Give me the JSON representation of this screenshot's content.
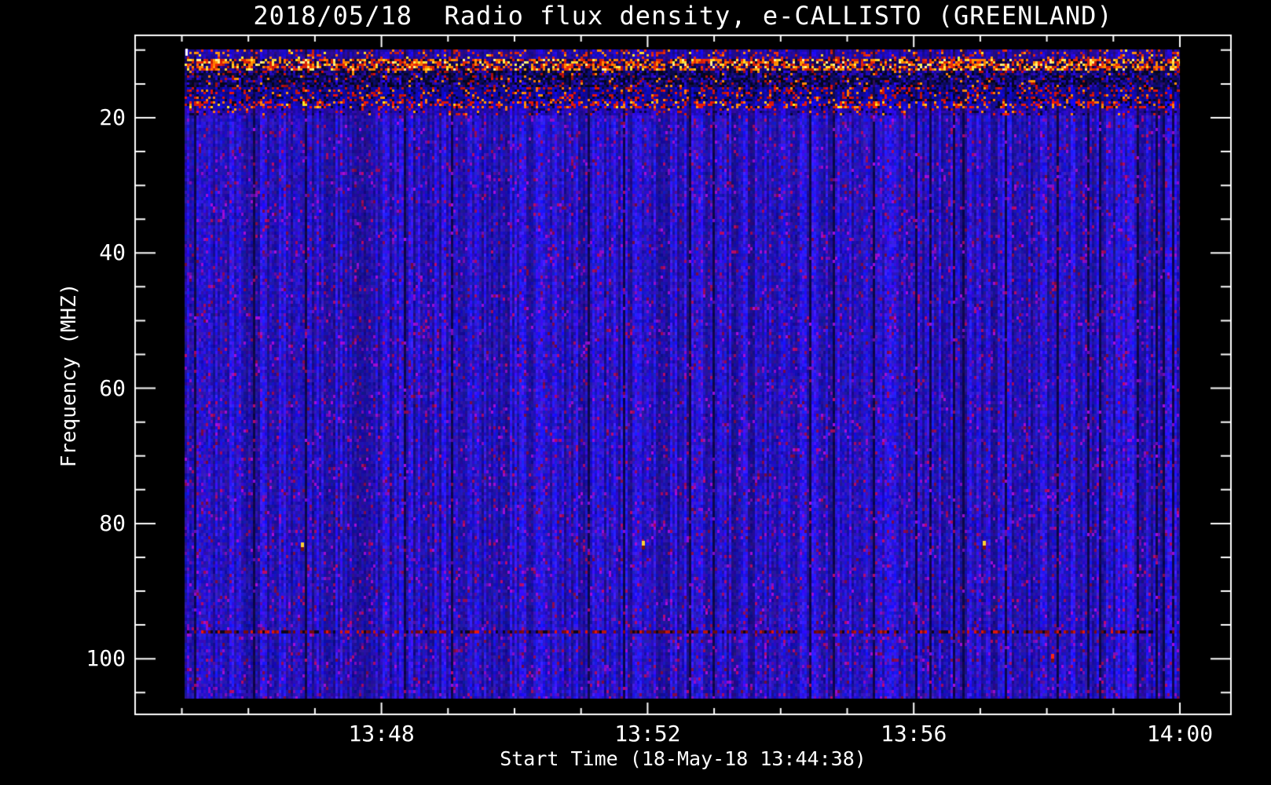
{
  "chart_data": {
    "type": "heatmap",
    "title": "2018/05/18  Radio flux density, e-CALLISTO (GREENLAND)",
    "xlabel": "Start Time (18-May-18 13:44:38)",
    "ylabel": "Frequency (MHZ)",
    "x_axis": {
      "start_time": "13:44:38",
      "end_time": "14:00:00",
      "major_ticks": [
        {
          "time": "13:48:00",
          "label": "13:48"
        },
        {
          "time": "13:52:00",
          "label": "13:52"
        },
        {
          "time": "13:56:00",
          "label": "13:56"
        },
        {
          "time": "14:00:00",
          "label": "14:00"
        }
      ],
      "minor_tick_every_minutes": 1
    },
    "y_axis": {
      "unit": "MHZ",
      "direction": "inverted-low-at-top",
      "data_min_mhz": 9.9,
      "data_max_mhz": 105.9,
      "major_ticks": [
        {
          "value": 20,
          "label": "20"
        },
        {
          "value": 40,
          "label": "40"
        },
        {
          "value": 60,
          "label": "60"
        },
        {
          "value": 80,
          "label": "80"
        },
        {
          "value": 100,
          "label": "100"
        }
      ],
      "minor_tick_every_mhz": 5
    },
    "palette": {
      "background": "#000000",
      "frame": "#ffffff",
      "text": "#ffffff",
      "field_blue": "#2222dd",
      "dark_navy": "#0a0a60",
      "speck_purple": "#7a1ab0",
      "speck_maroon": "#8b1a4a",
      "speck_red": "#d42810",
      "speck_orange": "#ff7a10",
      "speck_yellow": "#ffd330",
      "speck_pale_yellow": "#fff090",
      "fm_dark_red": "#6c1010"
    },
    "interference_bands": [
      {
        "from_mhz": 9.9,
        "to_mhz": 11.2,
        "style": "blue-sparse-red",
        "speck_density": 0.16
      },
      {
        "from_mhz": 11.2,
        "to_mhz": 12.9,
        "style": "intense-red-yellow",
        "speck_density": 0.58
      },
      {
        "from_mhz": 12.9,
        "to_mhz": 15.4,
        "style": "dark-mottled",
        "speck_density": 0.1
      },
      {
        "from_mhz": 15.4,
        "to_mhz": 17.3,
        "style": "dark-red-specks",
        "speck_density": 0.2
      },
      {
        "from_mhz": 17.3,
        "to_mhz": 18.4,
        "style": "red-speckle-row",
        "speck_density": 0.33
      },
      {
        "from_mhz": 18.4,
        "to_mhz": 19.5,
        "style": "transition-blue",
        "speck_density": 0.07
      }
    ],
    "narrowband_line": {
      "mhz": 95.8,
      "style": "dark-red-black-segments"
    },
    "point_events": [
      {
        "time": "13:46:47",
        "mhz": 82.8,
        "color": "#ffd330",
        "note": "bright dot"
      },
      {
        "time": "13:51:55",
        "mhz": 82.6,
        "color": "#ffd330",
        "note": "bright dot"
      },
      {
        "time": "13:57:02",
        "mhz": 82.6,
        "color": "#ffd330",
        "note": "bright dot"
      },
      {
        "time": "13:58:04",
        "mhz": 99.3,
        "color": "#ff2810",
        "note": "red speck"
      }
    ],
    "start_marker": {
      "time": "13:45:00",
      "mhz": 10.3,
      "color": "#ffffff"
    },
    "seed": 20180518
  }
}
